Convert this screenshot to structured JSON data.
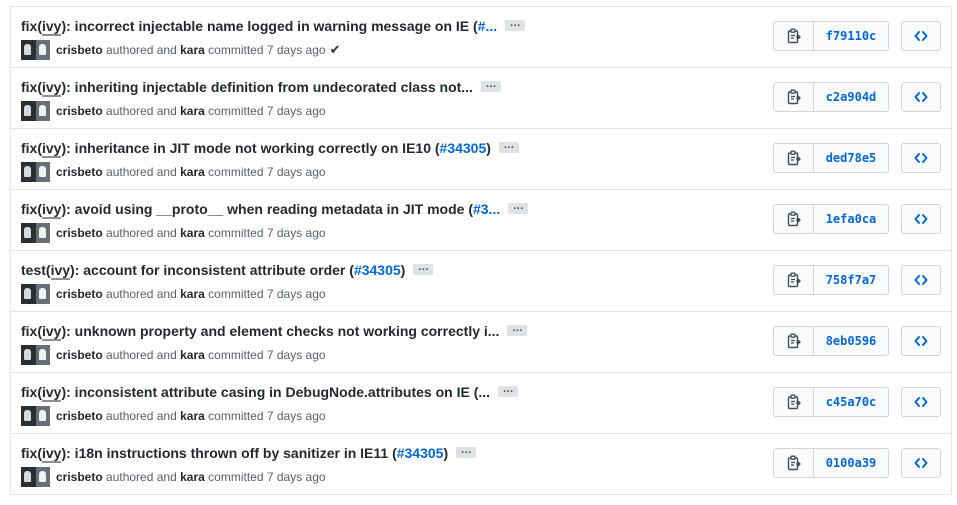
{
  "commits": [
    {
      "prefix": "fix(",
      "scope": "ivy",
      "summary": "): incorrect injectable name logged in warning message on IE (",
      "issue": "#...",
      "tail": "",
      "author": "crisbeto",
      "committer": "kara",
      "when": "7 days ago",
      "verified": true,
      "sha": "f79110c"
    },
    {
      "prefix": "fix(",
      "scope": "ivy",
      "summary": "): inheriting injectable definition from undecorated class not...",
      "issue": "",
      "tail": "",
      "author": "crisbeto",
      "committer": "kara",
      "when": "7 days ago",
      "verified": false,
      "sha": "c2a904d"
    },
    {
      "prefix": "fix(",
      "scope": "ivy",
      "summary": "): inheritance in JIT mode not working correctly on IE10 (",
      "issue": "#34305",
      "tail": ")",
      "author": "crisbeto",
      "committer": "kara",
      "when": "7 days ago",
      "verified": false,
      "sha": "ded78e5"
    },
    {
      "prefix": "fix(",
      "scope": "ivy",
      "summary": "): avoid using __proto__ when reading metadata in JIT mode (",
      "issue": "#3...",
      "tail": "",
      "author": "crisbeto",
      "committer": "kara",
      "when": "7 days ago",
      "verified": false,
      "sha": "1efa0ca"
    },
    {
      "prefix": "test(",
      "scope": "ivy",
      "summary": "): account for inconsistent attribute order (",
      "issue": "#34305",
      "tail": ")",
      "author": "crisbeto",
      "committer": "kara",
      "when": "7 days ago",
      "verified": false,
      "sha": "758f7a7"
    },
    {
      "prefix": "fix(",
      "scope": "ivy",
      "summary": "): unknown property and element checks not working correctly i...",
      "issue": "",
      "tail": "",
      "author": "crisbeto",
      "committer": "kara",
      "when": "7 days ago",
      "verified": false,
      "sha": "8eb0596"
    },
    {
      "prefix": "fix(",
      "scope": "ivy",
      "summary": "): inconsistent attribute casing in DebugNode.attributes on IE (...",
      "issue": "",
      "tail": "",
      "author": "crisbeto",
      "committer": "kara",
      "when": "7 days ago",
      "verified": false,
      "sha": "c45a70c"
    },
    {
      "prefix": "fix(",
      "scope": "ivy",
      "summary": "): i18n instructions thrown off by sanitizer in IE11 (",
      "issue": "#34305",
      "tail": ")",
      "author": "crisbeto",
      "committer": "kara",
      "when": "7 days ago",
      "verified": false,
      "sha": "0100a39"
    }
  ],
  "labels": {
    "authored": "authored and",
    "committed": "committed",
    "ellipsis": "…"
  },
  "icons": {
    "copy": "clipboard-icon",
    "browse": "code-icon",
    "verified": "check-icon"
  },
  "colors": {
    "link": "#0366d6",
    "text": "#24292e",
    "muted": "#586069",
    "border": "#e1e4e8"
  }
}
